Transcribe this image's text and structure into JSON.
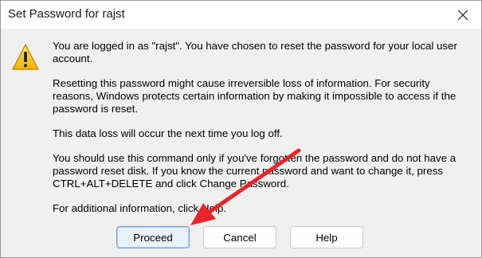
{
  "window": {
    "title": "Set Password for rajst"
  },
  "message": {
    "paragraphs": [
      "You are logged in as \"rajst\". You have chosen to reset the password for your local user account.",
      "Resetting this password might cause irreversible loss of information. For security reasons, Windows protects certain information by making it impossible to access if the password is reset.",
      "This data loss will occur the next time you log off.",
      "You should use this command only if you've forgotten the password and do not have a password reset disk. If you know the current password and want to change it, press CTRL+ALT+DELETE and click Change Password.",
      "For additional information, click Help."
    ]
  },
  "buttons": {
    "proceed": "Proceed",
    "cancel": "Cancel",
    "help": "Help"
  },
  "icons": {
    "warning": "warning-icon",
    "close": "close-icon",
    "arrow": "annotation-arrow"
  },
  "colors": {
    "arrow": "#e8262a",
    "primary_border": "#6e9cd8"
  }
}
